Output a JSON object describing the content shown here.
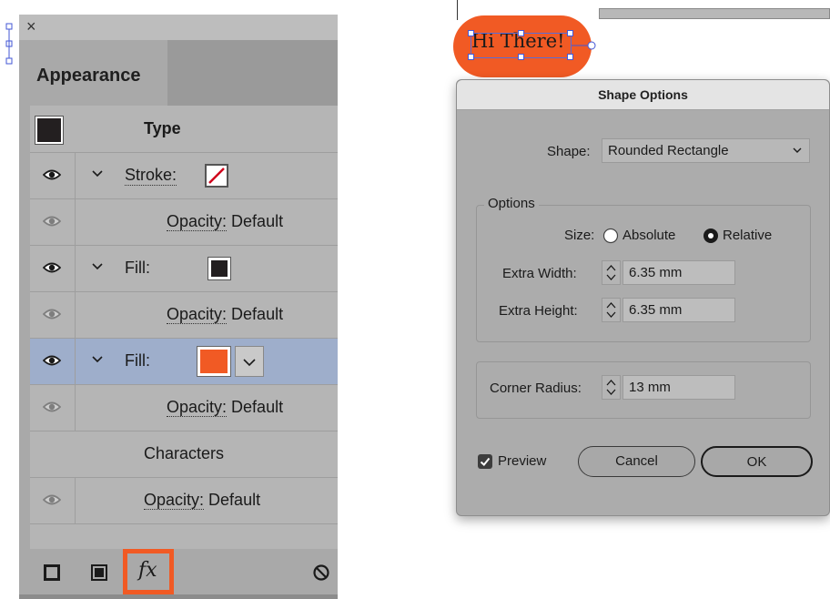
{
  "appearance": {
    "close_label": "×",
    "tab_label": "Appearance",
    "rows": {
      "type_label": "Type",
      "stroke_label": "Stroke:",
      "stroke_opacity_label": "Opacity:",
      "stroke_opacity_value": "Default",
      "fill1_label": "Fill:",
      "fill1_opacity_label": "Opacity:",
      "fill1_opacity_value": "Default",
      "fill2_label": "Fill:",
      "fill2_opacity_label": "Opacity:",
      "fill2_opacity_value": "Default",
      "characters_label": "Characters",
      "char_opacity_label": "Opacity:",
      "char_opacity_value": "Default"
    },
    "colors": {
      "fill1_swatch": "#231f20",
      "fill2_swatch": "#f15a24",
      "type_swatch": "#231f20",
      "selected_row": "#9eaecb",
      "fx_highlight": "#f15a24"
    },
    "footer": {
      "fx_label": "fx"
    }
  },
  "canvas": {
    "text": "Hi There!",
    "pill_color": "#f15a24"
  },
  "dialog": {
    "title": "Shape Options",
    "shape_label": "Shape:",
    "shape_value": "Rounded Rectangle",
    "options_group_label": "Options",
    "size_label": "Size:",
    "size_absolute": "Absolute",
    "size_relative": "Relative",
    "size_selected": "Relative",
    "extra_width_label": "Extra Width:",
    "extra_width_value": "6.35 mm",
    "extra_height_label": "Extra Height:",
    "extra_height_value": "6.35 mm",
    "corner_radius_label": "Corner Radius:",
    "corner_radius_value": "13 mm",
    "preview_label": "Preview",
    "preview_checked": true,
    "cancel_label": "Cancel",
    "ok_label": "OK"
  }
}
